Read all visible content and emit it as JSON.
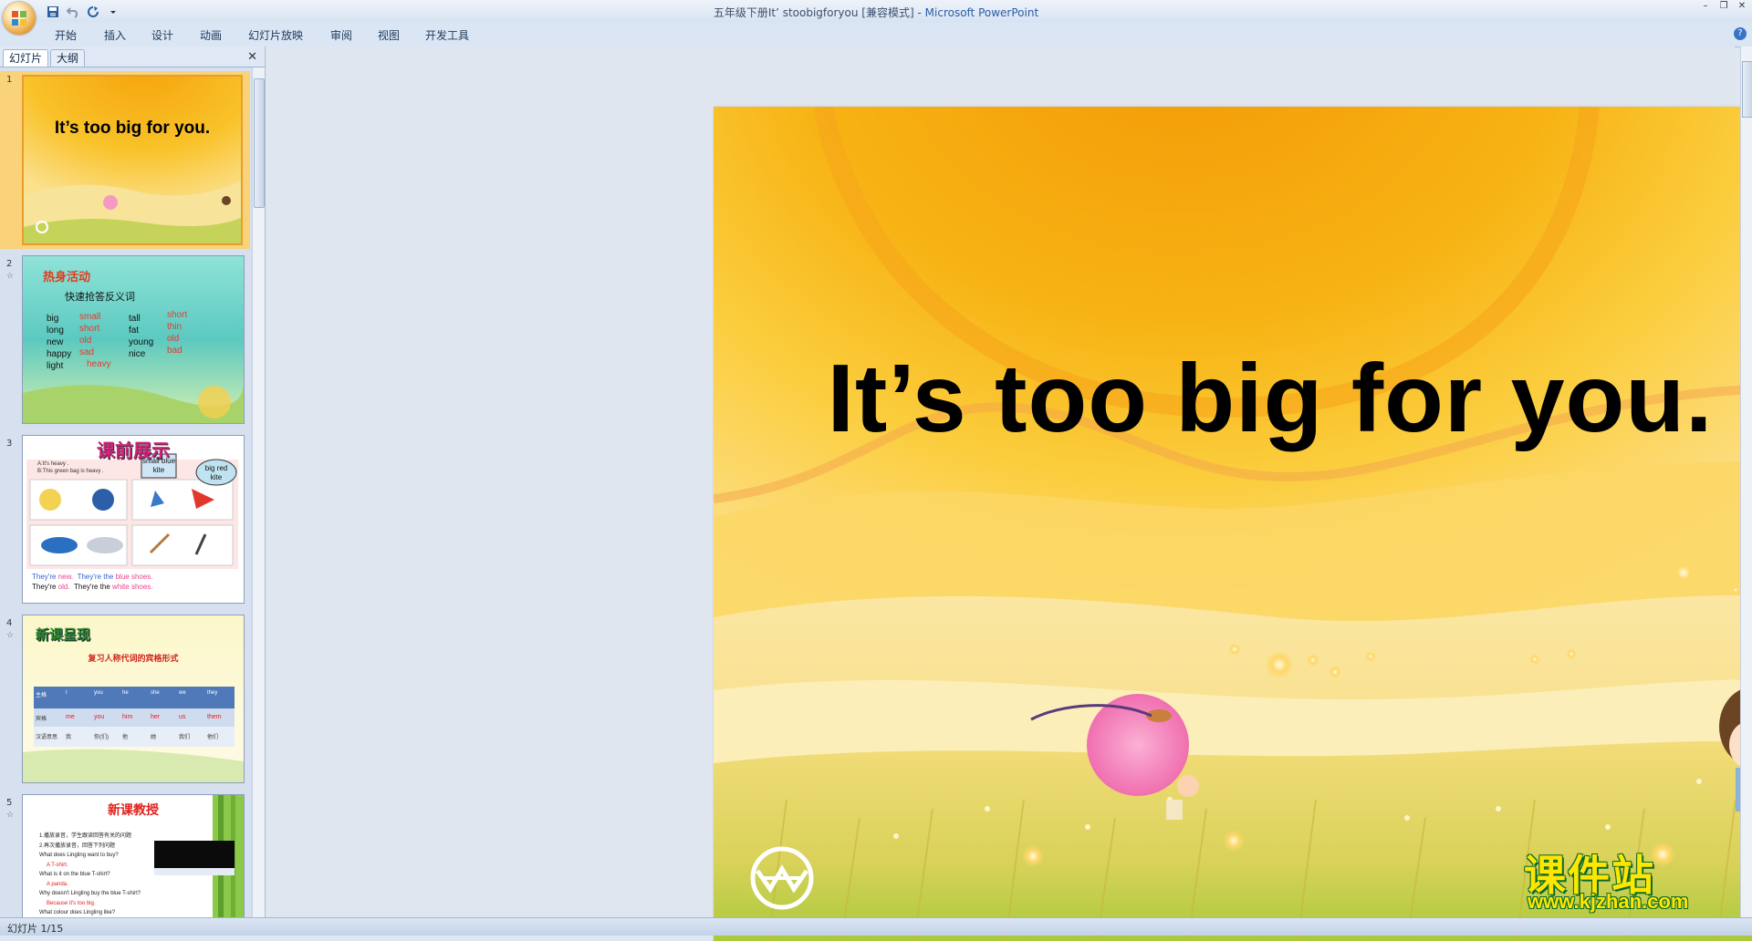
{
  "window": {
    "title": "五年级下册It’ stoobigforyou [兼容模式]",
    "app_name": "Microsoft PowerPoint",
    "title_separator": "-"
  },
  "ribbon": {
    "tabs": [
      "开始",
      "插入",
      "设计",
      "动画",
      "幻灯片放映",
      "审阅",
      "视图",
      "开发工具"
    ]
  },
  "left_pane": {
    "tab_slides": "幻灯片",
    "tab_outline": "大纲"
  },
  "thumbnails": [
    {
      "number": "1",
      "title": "It’s too big for you."
    },
    {
      "number": "2",
      "heading": "热身活动",
      "subtitle": "快速抢答反义词",
      "col1": [
        "big",
        "long",
        "new",
        "happy",
        "light"
      ],
      "col2": [
        "small",
        "short",
        "old",
        "sad",
        "heavy"
      ],
      "col3": [
        "tall",
        "fat",
        "young",
        "nice"
      ],
      "col4": [
        "short",
        "thin",
        "old",
        "bad"
      ]
    },
    {
      "number": "3",
      "heading": "课前展示",
      "line1": "A:It's heavy .",
      "line2": "B:This green bag is heavy .",
      "bubble1": "small blue kite",
      "bubble2": "big red kite",
      "footer1a": "They're",
      "footer1b": "new.",
      "footer1c": "They're the",
      "footer1d": "blue shoes.",
      "footer2a": "They're",
      "footer2b": "old.",
      "footer2c": "They're the",
      "footer2d": "white shoes."
    },
    {
      "number": "4",
      "heading": "新课呈现",
      "subtitle": "复习人称代词的宾格形式",
      "table_header": [
        "主格",
        "I",
        "you",
        "he",
        "she",
        "we",
        "they"
      ],
      "table_row1": [
        "宾格",
        "me",
        "you",
        "him",
        "her",
        "us",
        "them"
      ],
      "table_row2": [
        "汉语意思",
        "我",
        "你(们)",
        "他",
        "她",
        "我们",
        "他们"
      ]
    },
    {
      "number": "5",
      "heading": "新课教授",
      "lines": [
        "1.播放录音，学生跟读回答有关的问题",
        "2.再次播放录音，回答下列问题",
        "What does Lingling want to buy?",
        "A T-shirt.",
        "What is it on the blue T-shirt?",
        "A panda.",
        "Why doesn't Lingling buy the blue T-shirt?",
        "Because it's too big.",
        "What colour does Lingling like?"
      ]
    }
  ],
  "slide": {
    "title": "It’s too big for you."
  },
  "status": {
    "slide_indicator": "幻灯片 1/15"
  },
  "watermark": {
    "text": "课件站",
    "url": "www.kjzhan.com"
  },
  "colors": {
    "ribbon": "#dbe6f4",
    "selected_thumb_border": "#e79e2c",
    "watermark_yellow": "#ffe600",
    "watermark_green": "#0b6b2a"
  }
}
